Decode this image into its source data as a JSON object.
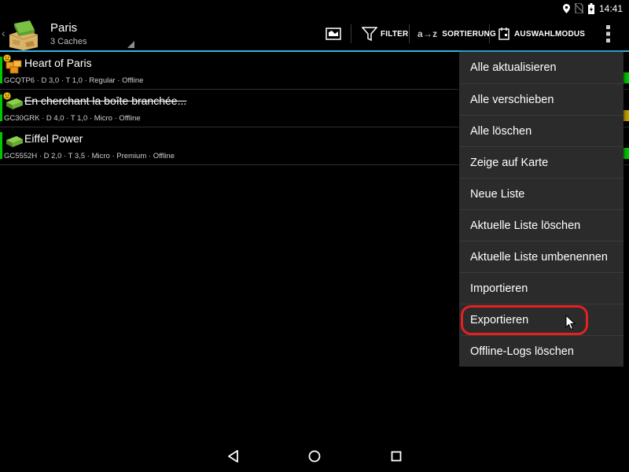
{
  "status_bar": {
    "time": "14:41",
    "icons": [
      "location-icon",
      "no-sim-icon",
      "battery-charging-icon"
    ]
  },
  "action_bar": {
    "list_title": "Paris",
    "list_subtitle": "3 Caches",
    "map_icon": "map-icon",
    "filter_label": "FILTER",
    "sort_label": "SORTIERUNG",
    "sort_icon_text": "a→z",
    "select_mode_label": "AUSWAHLMODUS",
    "overflow_icon": "overflow-menu-icon",
    "accent_color": "#33b5e5"
  },
  "caches": [
    {
      "name": "Heart of Paris",
      "info": "GCQTP6 · D 3,0 · T 1,0 · Regular · Offline",
      "strikethrough": false,
      "icon": "multi-cache-icon"
    },
    {
      "name": "En cherchant la boîte branchée...",
      "info": "GC30GRK · D 4,0 · T 1,0 · Micro · Offline",
      "strikethrough": true,
      "icon": "traditional-cache-icon"
    },
    {
      "name": "Eiffel Power",
      "info": "GC5552H · D 2,0 · T 3,5 · Micro · Premium · Offline",
      "strikethrough": false,
      "icon": "traditional-cache-icon"
    }
  ],
  "overflow_menu": {
    "items": [
      "Alle aktualisieren",
      "Alle verschieben",
      "Alle löschen",
      "Zeige auf Karte",
      "Neue Liste",
      "Aktuelle Liste löschen",
      "Aktuelle Liste umbenennen",
      "Importieren",
      "Exportieren",
      "Offline-Logs löschen"
    ],
    "highlighted_item": "Exportieren",
    "highlight_color": "#e52020"
  },
  "nav_bar": {
    "buttons": [
      "back-icon",
      "home-icon",
      "recents-icon"
    ]
  }
}
